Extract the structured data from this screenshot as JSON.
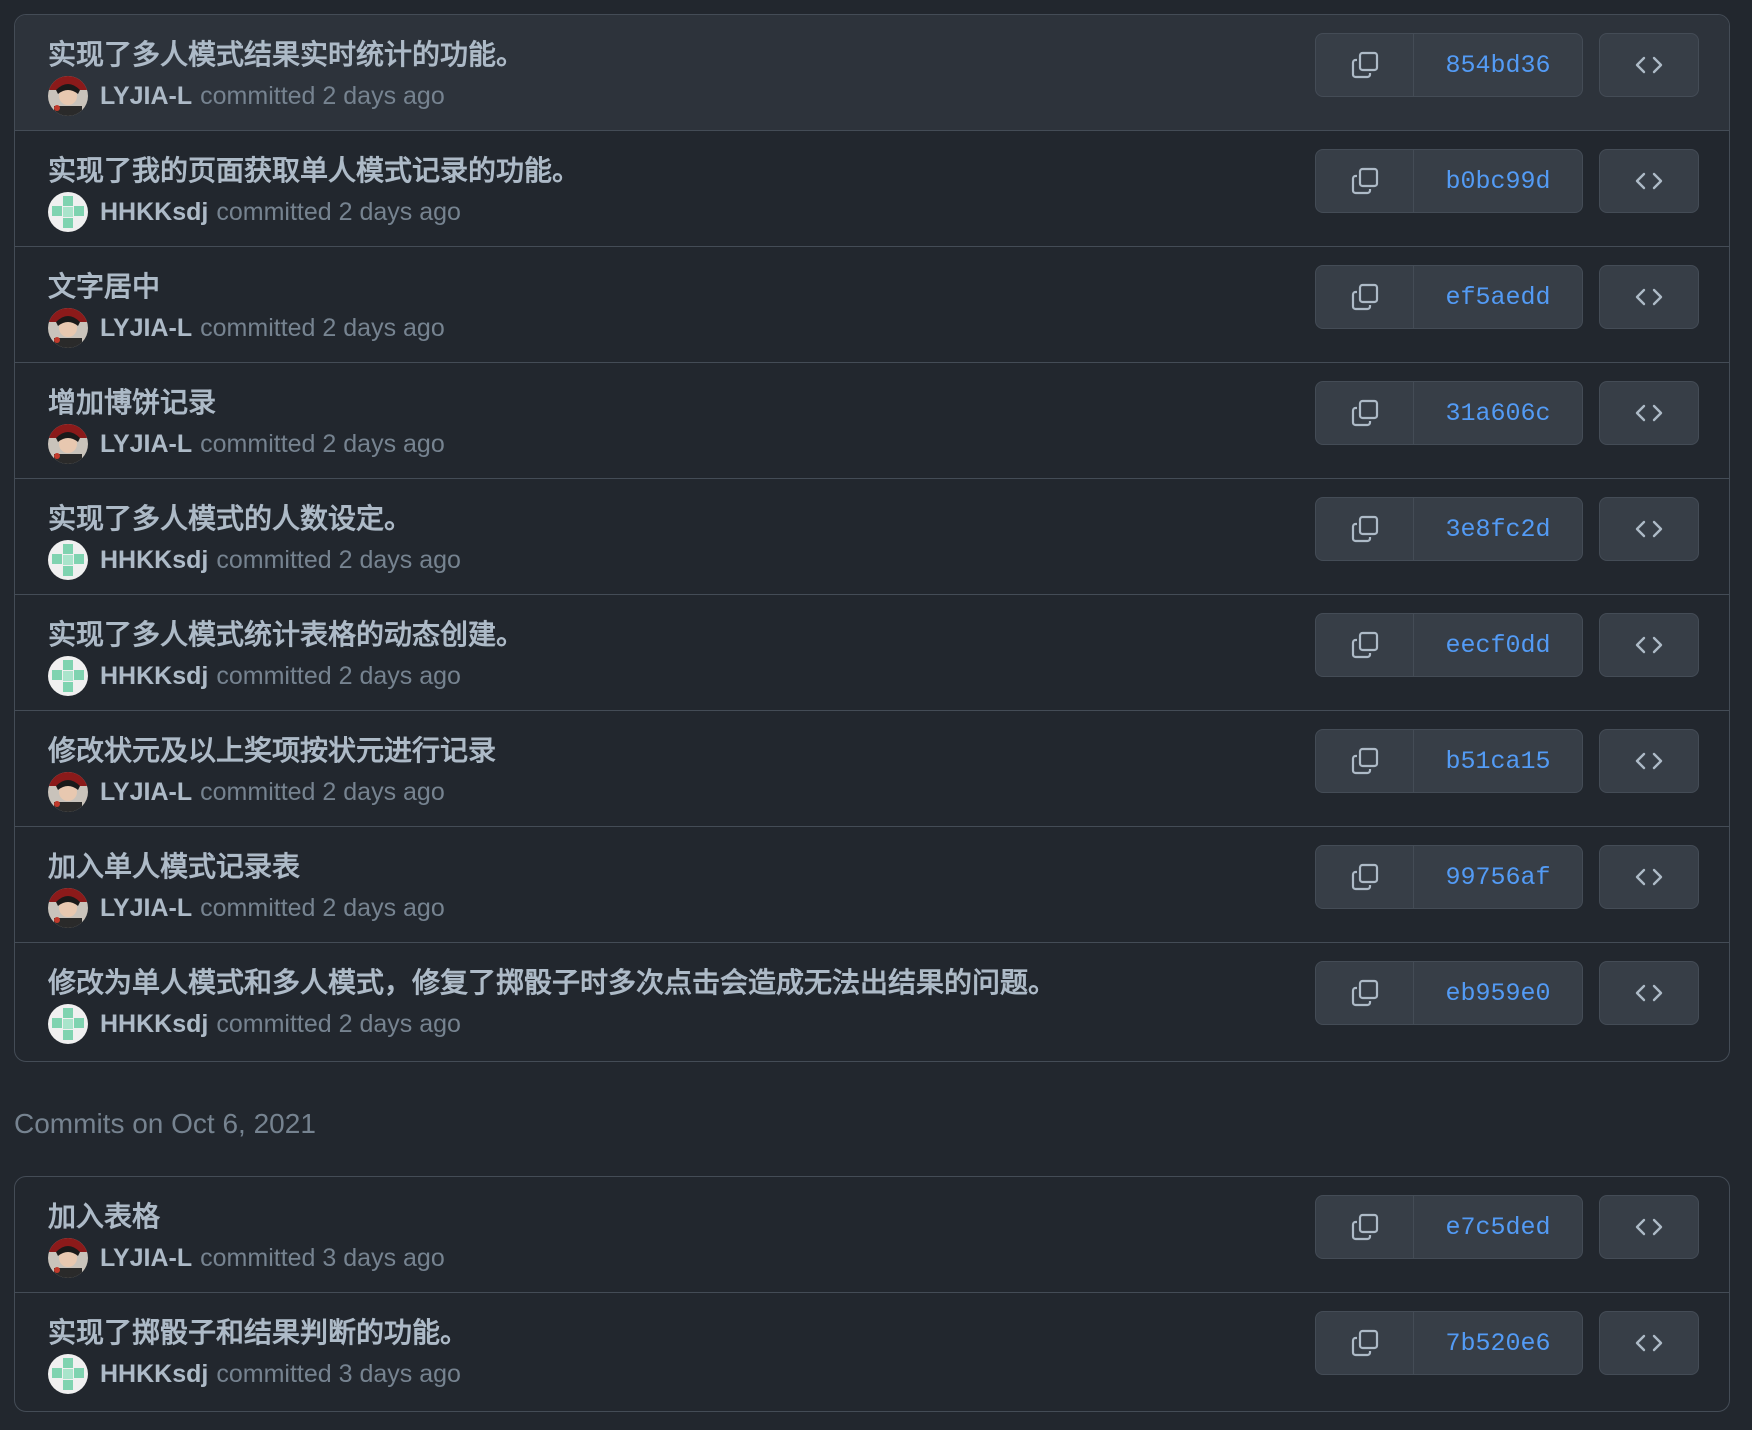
{
  "group_heading": "Commits on Oct 6, 2021",
  "colors": {
    "bg": "#22272e",
    "border": "#444c56",
    "sha": "#539bf5",
    "muted": "#768390"
  },
  "groups": [
    {
      "commits": [
        {
          "message": "实现了多人模式结果实时统计的功能。",
          "author": "LYJIA-L",
          "time": "committed 2 days ago",
          "sha": "854bd36",
          "avatar": "photo-avatar"
        },
        {
          "message": "实现了我的页面获取单人模式记录的功能。",
          "author": "HHKKsdj",
          "time": "committed 2 days ago",
          "sha": "b0bc99d",
          "avatar": "identicon-avatar"
        },
        {
          "message": "文字居中",
          "author": "LYJIA-L",
          "time": "committed 2 days ago",
          "sha": "ef5aedd",
          "avatar": "photo-avatar"
        },
        {
          "message": "增加博饼记录",
          "author": "LYJIA-L",
          "time": "committed 2 days ago",
          "sha": "31a606c",
          "avatar": "photo-avatar"
        },
        {
          "message": "实现了多人模式的人数设定。",
          "author": "HHKKsdj",
          "time": "committed 2 days ago",
          "sha": "3e8fc2d",
          "avatar": "identicon-avatar"
        },
        {
          "message": "实现了多人模式统计表格的动态创建。",
          "author": "HHKKsdj",
          "time": "committed 2 days ago",
          "sha": "eecf0dd",
          "avatar": "identicon-avatar"
        },
        {
          "message": "修改状元及以上奖项按状元进行记录",
          "author": "LYJIA-L",
          "time": "committed 2 days ago",
          "sha": "b51ca15",
          "avatar": "photo-avatar"
        },
        {
          "message": "加入单人模式记录表",
          "author": "LYJIA-L",
          "time": "committed 2 days ago",
          "sha": "99756af",
          "avatar": "photo-avatar"
        },
        {
          "message": "修改为单人模式和多人模式，修复了掷骰子时多次点击会造成无法出结果的问题。",
          "author": "HHKKsdj",
          "time": "committed 2 days ago",
          "sha": "eb959e0",
          "avatar": "identicon-avatar"
        }
      ]
    },
    {
      "commits": [
        {
          "message": "加入表格",
          "author": "LYJIA-L",
          "time": "committed 3 days ago",
          "sha": "e7c5ded",
          "avatar": "photo-avatar"
        },
        {
          "message": "实现了掷骰子和结果判断的功能。",
          "author": "HHKKsdj",
          "time": "committed 3 days ago",
          "sha": "7b520e6",
          "avatar": "identicon-avatar"
        }
      ]
    }
  ],
  "icons": {
    "copy": "copy-icon",
    "browse": "code-icon"
  }
}
